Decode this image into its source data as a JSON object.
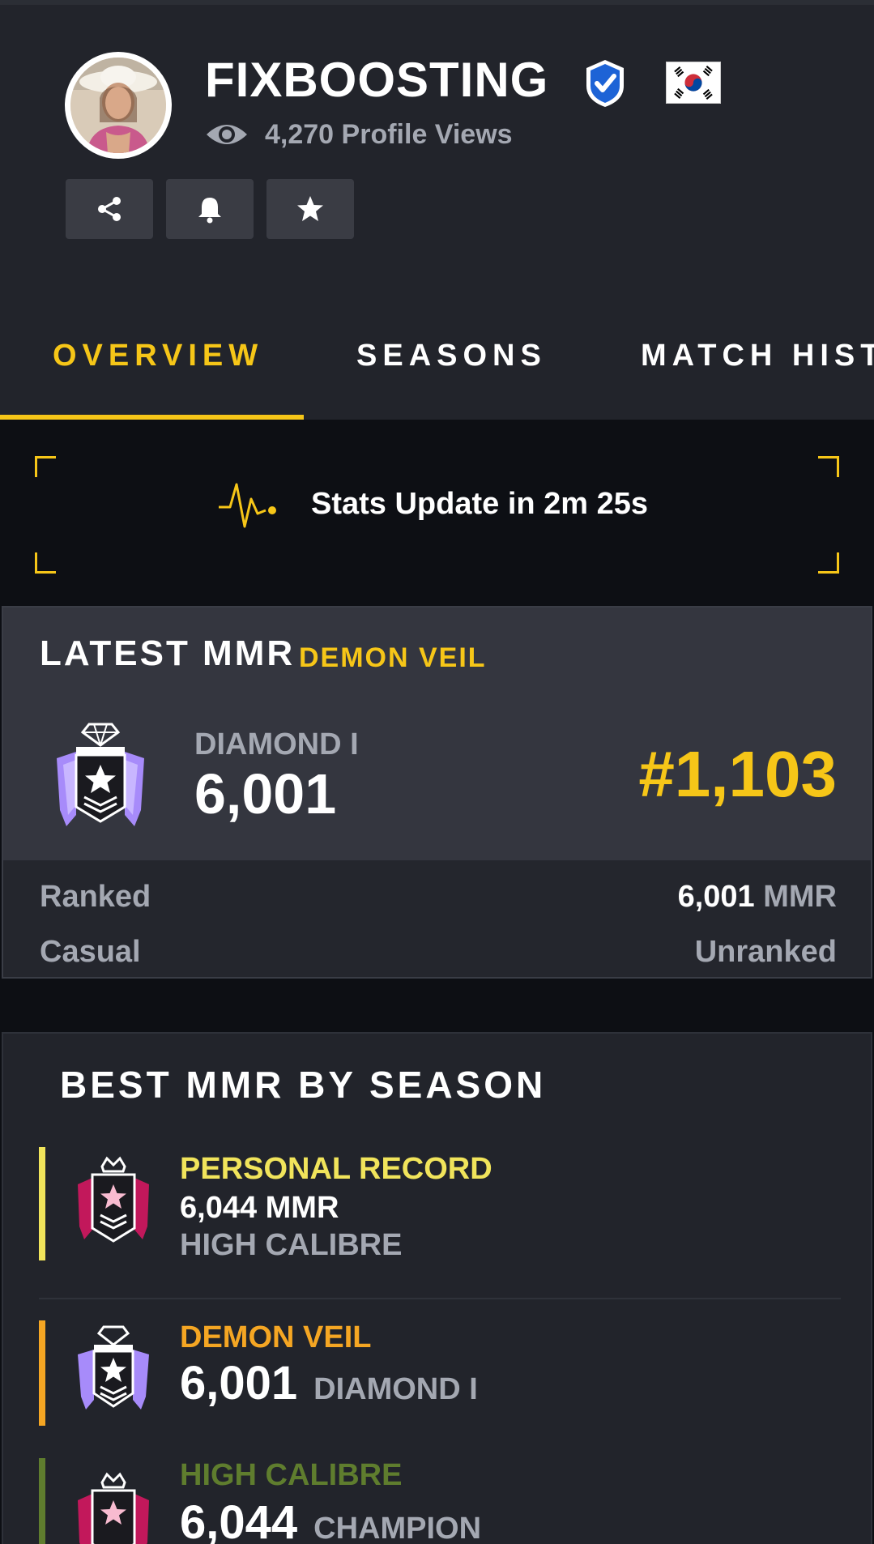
{
  "profile": {
    "username": "FIXBOOSTING",
    "views_count": "4,270",
    "views_label": "Profile Views",
    "verified": true,
    "country_flag": "south-korea-flag"
  },
  "actions": [
    {
      "icon": "share-icon"
    },
    {
      "icon": "bell-icon"
    },
    {
      "icon": "star-icon"
    }
  ],
  "tabs": [
    {
      "label": "OVERVIEW",
      "active": true
    },
    {
      "label": "SEASONS",
      "active": false
    },
    {
      "label": "MATCH HIST",
      "active": false
    }
  ],
  "stats_update": {
    "text": "Stats Update in 2m 25s",
    "icon": "pulse-icon"
  },
  "latest_mmr": {
    "title": "LATEST MMR",
    "season": "DEMON VEIL",
    "rank_name": "DIAMOND I",
    "mmr": "6,001",
    "position": "#1,103",
    "modes": [
      {
        "name": "Ranked",
        "value": "6,001",
        "unit": "MMR"
      },
      {
        "name": "Casual",
        "value": "Unranked"
      }
    ]
  },
  "best_mmr": {
    "title": "BEST MMR BY SEASON",
    "rows": [
      {
        "name": "PERSONAL RECORD",
        "line2": "6,044 MMR",
        "line3": "HIGH CALIBRE",
        "color": "#f1e45b",
        "icon": "champion-rank-icon"
      },
      {
        "name": "DEMON VEIL",
        "mmr": "6,001",
        "rank": "DIAMOND I",
        "color": "#f5a623",
        "icon": "diamond-rank-icon"
      },
      {
        "name": "HIGH CALIBRE",
        "mmr": "6,044",
        "rank": "CHAMPION",
        "color": "#5f7d2e",
        "icon": "champion-rank-icon"
      }
    ]
  },
  "colors": {
    "accent": "#f6c618",
    "background": "#22242b",
    "muted_text": "#a4a8b2"
  }
}
